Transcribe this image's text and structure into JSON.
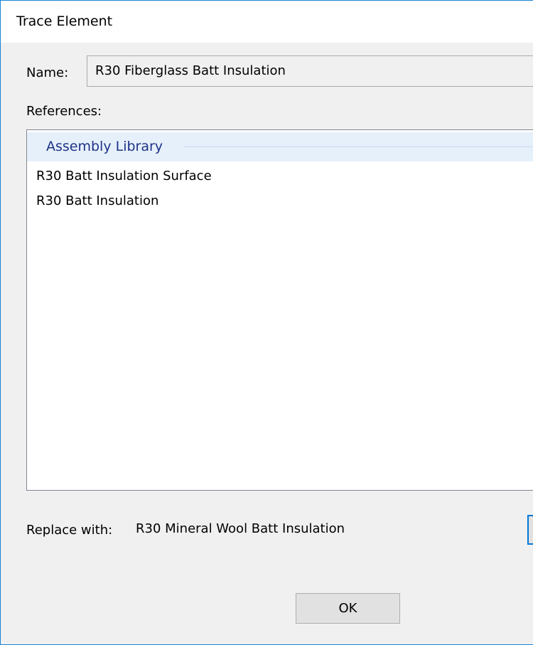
{
  "window": {
    "title": "Trace Element"
  },
  "name": {
    "label": "Name:",
    "value": "R30 Fiberglass Batt Insulation"
  },
  "references": {
    "label": "References:",
    "groups": [
      {
        "title": "Assembly Library",
        "items": [
          "R30 Batt Insulation Surface",
          "R30 Batt Insulation"
        ]
      }
    ]
  },
  "replace": {
    "label": "Replace with:",
    "value": "R30 Mineral Wool Batt Insulation"
  },
  "buttons": {
    "ok_label": "OK"
  },
  "colors": {
    "window_border": "#1883d7",
    "group_header_bg": "#e6f0fa",
    "group_title": "#1e3287",
    "focus_border": "#0078d7"
  }
}
